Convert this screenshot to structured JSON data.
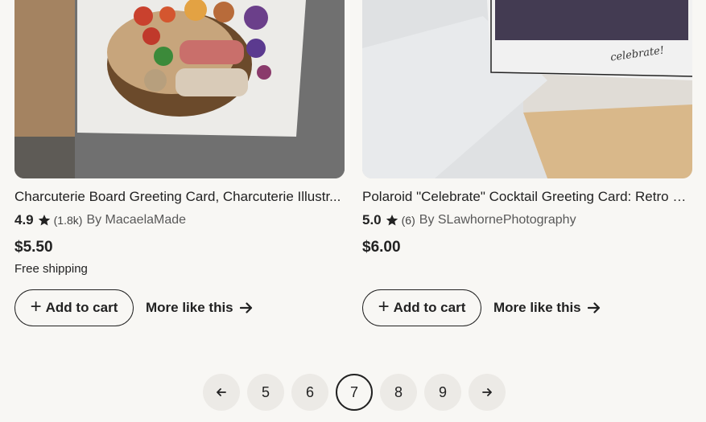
{
  "products": [
    {
      "title": "Charcuterie Board Greeting Card, Charcuterie Illustr...",
      "rating": "4.9",
      "review_count": "(1.8k)",
      "by_label": "By MacaelaMade",
      "price": "$5.50",
      "shipping": "Free shipping",
      "add_to_cart": "Add to cart",
      "more_like_this": "More like this"
    },
    {
      "title": "Polaroid \"Celebrate\" Cocktail Greeting Card: Retro P...",
      "rating": "5.0",
      "review_count": "(6)",
      "by_label": "By SLawhornePhotography",
      "price": "$6.00",
      "shipping": "",
      "add_to_cart": "Add to cart",
      "more_like_this": "More like this",
      "image_caption": "celebrate!"
    }
  ],
  "pagination": {
    "pages": [
      "5",
      "6",
      "7",
      "8",
      "9"
    ],
    "current": "7"
  },
  "icons": {
    "star": "star-icon",
    "plus": "plus-icon",
    "arrow": "arrow-right-icon",
    "prev": "arrow-left-icon",
    "next": "arrow-right-icon"
  },
  "colors": {
    "background": "#f8f7f4",
    "text": "#222222",
    "muted": "#595959",
    "page_button": "#eceae6"
  }
}
